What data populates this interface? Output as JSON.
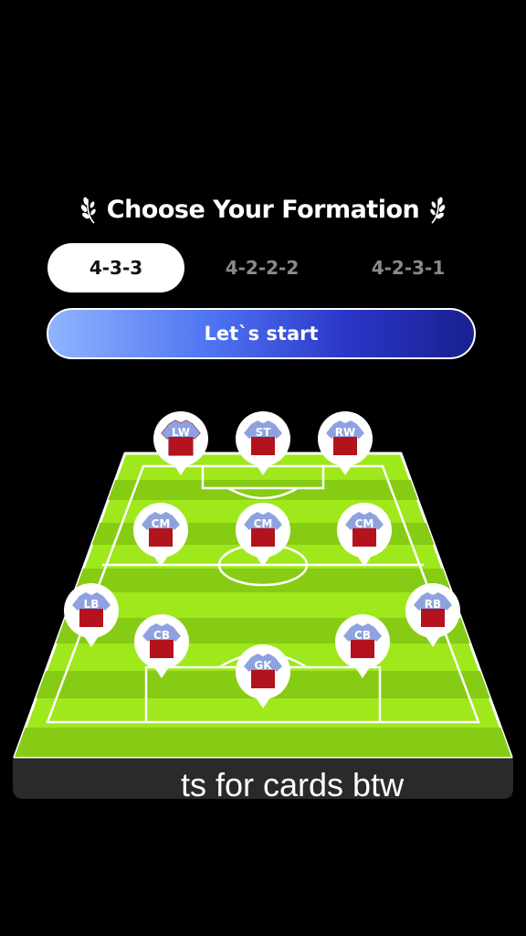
{
  "header": {
    "title": "Choose Your Formation",
    "laurel_icon": "laurel-icon"
  },
  "formations": [
    {
      "label": "4-3-3",
      "active": true
    },
    {
      "label": "4-2-2-2",
      "active": false
    },
    {
      "label": "4-2-3-1",
      "active": false
    }
  ],
  "start_button": {
    "label": "Let`s start"
  },
  "pitch": {
    "players": [
      {
        "pos": "LW"
      },
      {
        "pos": "ST"
      },
      {
        "pos": "RW"
      },
      {
        "pos": "CM"
      },
      {
        "pos": "CM"
      },
      {
        "pos": "CM"
      },
      {
        "pos": "LB"
      },
      {
        "pos": "CB"
      },
      {
        "pos": "CB"
      },
      {
        "pos": "RB"
      },
      {
        "pos": "GK"
      }
    ]
  },
  "caption": "ts for cards btw",
  "colors": {
    "grass_light": "#9ee81c",
    "grass_dark": "#86cc14",
    "jersey_red": "#b3131d",
    "jersey_sleeve": "#8ea2df",
    "button_gradient_start": "#8fb4ff",
    "button_gradient_end": "#19208f"
  }
}
